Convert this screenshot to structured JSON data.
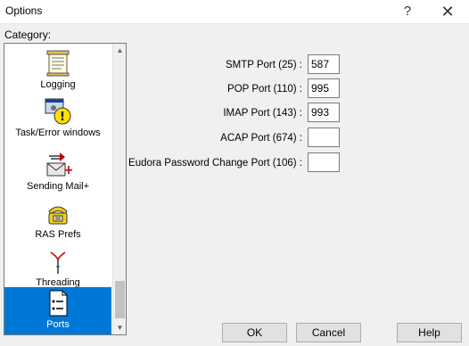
{
  "window": {
    "title": "Options",
    "help_glyph": "?",
    "close_glyph": "✕"
  },
  "category": {
    "label": "Category:",
    "items": [
      {
        "label": "Logging",
        "icon": "logging-icon",
        "selected": false
      },
      {
        "label": "Task/Error windows",
        "icon": "task-error-icon",
        "selected": false
      },
      {
        "label": "Sending Mail+",
        "icon": "sending-mail-icon",
        "selected": false
      },
      {
        "label": "RAS Prefs",
        "icon": "ras-prefs-icon",
        "selected": false
      },
      {
        "label": "Threading",
        "icon": "threading-icon",
        "selected": false
      },
      {
        "label": "Ports",
        "icon": "ports-icon",
        "selected": true
      }
    ]
  },
  "ports": {
    "smtp": {
      "label": "SMTP Port (25) :",
      "value": "587"
    },
    "pop": {
      "label": "POP Port (110) :",
      "value": "995"
    },
    "imap": {
      "label": "IMAP Port (143) :",
      "value": "993"
    },
    "acap": {
      "label": "ACAP Port (674) :",
      "value": ""
    },
    "eudora": {
      "label": "Eudora Password Change Port (106) :",
      "value": ""
    }
  },
  "buttons": {
    "ok": "OK",
    "cancel": "Cancel",
    "help": "Help"
  },
  "colors": {
    "selection": "#0078d7",
    "dialog_bg": "#f0f0f0"
  }
}
